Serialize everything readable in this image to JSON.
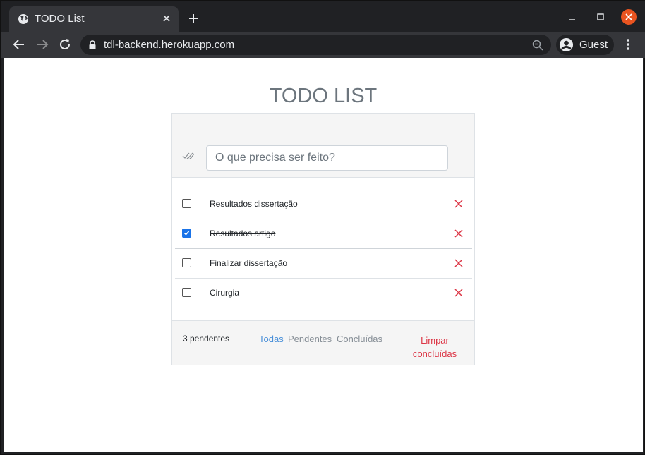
{
  "browser": {
    "tab_title": "TODO List",
    "url": "tdl-backend.herokuapp.com",
    "profile_name": "Guest"
  },
  "app": {
    "title": "TODO LIST",
    "input_placeholder": "O que precisa ser feito?",
    "todos": [
      {
        "label": "Resultados dissertação",
        "done": false
      },
      {
        "label": "Resultados artigo",
        "done": true
      },
      {
        "label": "Finalizar dissertação",
        "done": false
      },
      {
        "label": "Cirurgia",
        "done": false
      }
    ],
    "footer": {
      "count": "3 pendentes",
      "filter_all": "Todas",
      "filter_active": "Pendentes",
      "filter_done": "Concluídas",
      "clear_line1": "Limpar",
      "clear_line2": "concluídas"
    }
  },
  "colors": {
    "accent": "#4a90d9",
    "danger": "#dc3545",
    "close_button": "#e95420"
  }
}
